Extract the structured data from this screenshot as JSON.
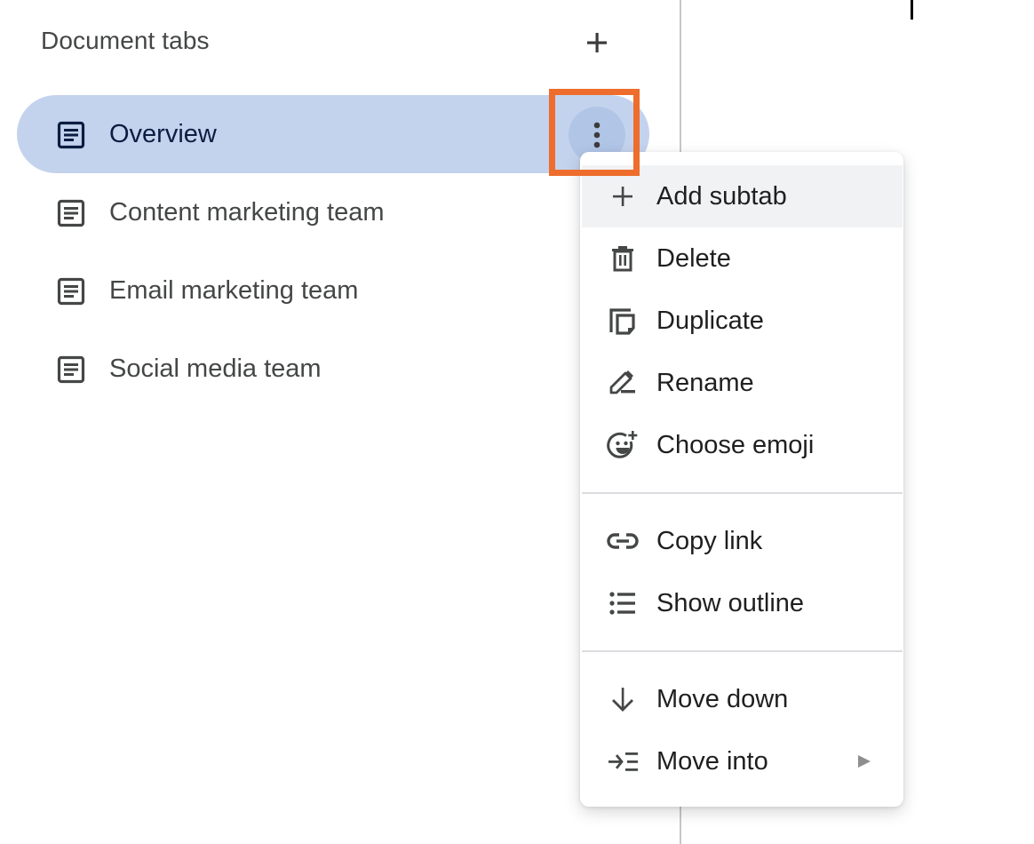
{
  "panel": {
    "title": "Document tabs",
    "add_tab_icon": "plus-icon"
  },
  "tabs": [
    {
      "label": "Overview",
      "icon": "document-icon",
      "active": true
    },
    {
      "label": "Content marketing team",
      "icon": "document-icon",
      "active": false
    },
    {
      "label": "Email marketing team",
      "icon": "document-icon",
      "active": false
    },
    {
      "label": "Social media team",
      "icon": "document-icon",
      "active": false
    }
  ],
  "tab_options_icon": "more-vert-icon",
  "context_menu": {
    "groups": [
      [
        {
          "label": "Add subtab",
          "icon": "plus-icon",
          "highlighted": true
        },
        {
          "label": "Delete",
          "icon": "trash-icon"
        },
        {
          "label": "Duplicate",
          "icon": "duplicate-icon"
        },
        {
          "label": "Rename",
          "icon": "rename-pencil-icon"
        },
        {
          "label": "Choose emoji",
          "icon": "add-emoji-icon"
        }
      ],
      [
        {
          "label": "Copy link",
          "icon": "link-icon"
        },
        {
          "label": "Show outline",
          "icon": "list-outline-icon"
        }
      ],
      [
        {
          "label": "Move down",
          "icon": "arrow-down-icon"
        },
        {
          "label": "Move into",
          "icon": "move-into-icon",
          "submenu": true
        }
      ]
    ]
  },
  "colors": {
    "active_tab_bg": "#c4d3ed",
    "highlight_outline": "#ee6d2c",
    "menu_hover_bg": "#f1f2f4"
  }
}
